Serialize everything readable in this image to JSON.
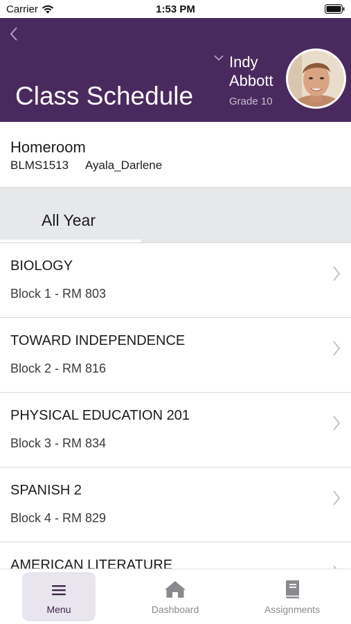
{
  "status_bar": {
    "carrier": "Carrier",
    "time": "1:53 PM"
  },
  "header": {
    "title": "Class Schedule",
    "student_name": "Indy\nAbbott",
    "grade": "Grade 10",
    "background_color": "#4a2a5e"
  },
  "homeroom": {
    "title": "Homeroom",
    "code": "BLMS1513",
    "teacher": "Ayala_Darlene"
  },
  "term_tabs": [
    {
      "label": "All Year",
      "selected": true
    }
  ],
  "courses": [
    {
      "name": "BIOLOGY",
      "location": "Block 1 - RM 803"
    },
    {
      "name": "TOWARD INDEPENDENCE",
      "location": "Block 2 - RM 816"
    },
    {
      "name": "PHYSICAL EDUCATION 201",
      "location": "Block 3 - RM 834"
    },
    {
      "name": "SPANISH 2",
      "location": "Block 4 - RM 829"
    },
    {
      "name": "AMERICAN LITERATURE",
      "location": ""
    }
  ],
  "tab_bar": {
    "menu": {
      "label": "Menu",
      "icon": "hamburger-icon",
      "selected": true
    },
    "dashboard": {
      "label": "Dashboard",
      "icon": "home-icon"
    },
    "assignments": {
      "label": "Assignments",
      "icon": "book-icon"
    }
  }
}
